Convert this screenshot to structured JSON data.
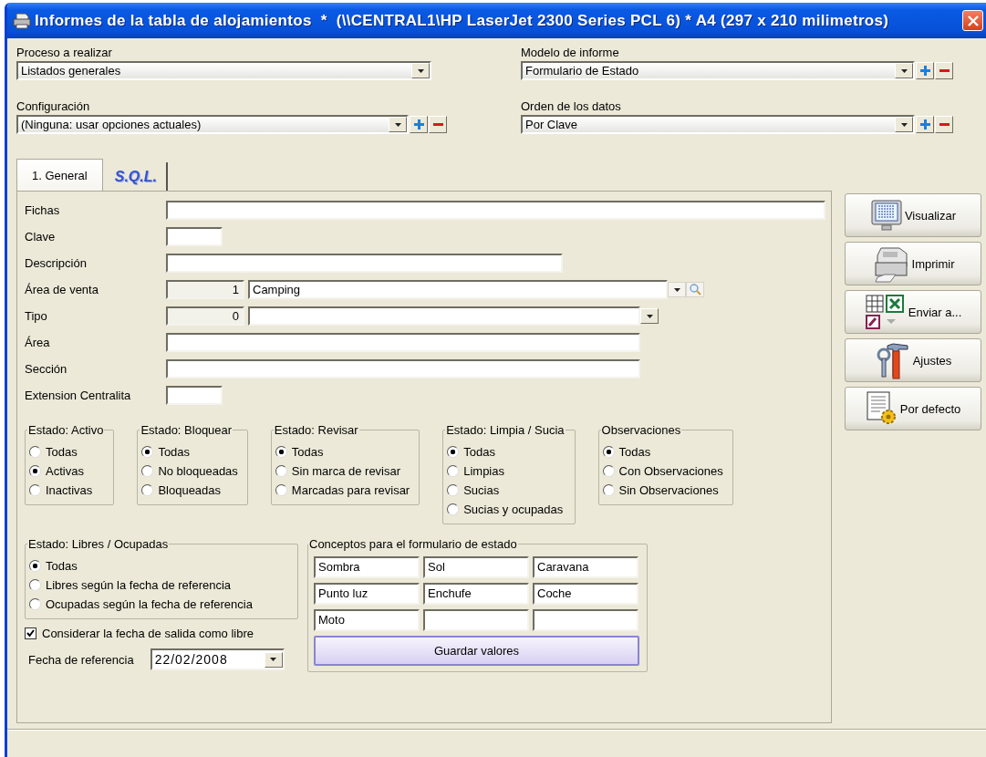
{
  "window": {
    "title": "Informes de la tabla de alojamientos  *  (\\\\CENTRAL1\\HP LaserJet 2300 Series PCL 6) * A4 (297 x 210 milimetros)"
  },
  "top_fields": [
    {
      "label": "Proceso a realizar",
      "value": "Listados generales",
      "kind": "combo"
    },
    {
      "label": "Modelo de informe",
      "value": "Formulario de Estado",
      "kind": "combo-add-remove"
    },
    {
      "label": "Configuración",
      "value": "(Ninguna: usar opciones actuales)",
      "kind": "combo-add-remove"
    },
    {
      "label": "Orden de los datos",
      "value": "Por Clave",
      "kind": "combo-add-remove"
    }
  ],
  "tabs": [
    {
      "label": "1. General",
      "selected": true,
      "kind": "plain"
    },
    {
      "label": "S.Q.L.",
      "selected": false,
      "kind": "styled"
    }
  ],
  "form_fields": [
    {
      "label": "Fichas",
      "kind": "wide"
    },
    {
      "label": "Clave",
      "kind": "short"
    },
    {
      "label": "Descripción",
      "kind": "medium"
    },
    {
      "label": "Área de venta",
      "kind": "lookup",
      "code": "1",
      "value": "Camping"
    },
    {
      "label": "Tipo",
      "kind": "code-combo",
      "code": "0"
    },
    {
      "label": "Área",
      "kind": "long"
    },
    {
      "label": "Sección",
      "kind": "long"
    },
    {
      "label": "Extension Centralita",
      "kind": "short"
    }
  ],
  "radio_groups": [
    {
      "title": "Estado: Activo",
      "options": [
        {
          "label": "Todas",
          "selected": false
        },
        {
          "label": "Activas",
          "selected": true
        },
        {
          "label": "Inactivas",
          "selected": false
        }
      ]
    },
    {
      "title": "Estado: Bloquear",
      "options": [
        {
          "label": "Todas",
          "selected": true
        },
        {
          "label": "No bloqueadas",
          "selected": false
        },
        {
          "label": "Bloqueadas",
          "selected": false
        }
      ]
    },
    {
      "title": "Estado: Revisar",
      "options": [
        {
          "label": "Todas",
          "selected": true
        },
        {
          "label": "Sin marca de revisar",
          "selected": false
        },
        {
          "label": "Marcadas para revisar",
          "selected": false
        }
      ]
    },
    {
      "title": "Estado: Limpia / Sucia",
      "options": [
        {
          "label": "Todas",
          "selected": true
        },
        {
          "label": "Limpias",
          "selected": false
        },
        {
          "label": "Sucias",
          "selected": false
        },
        {
          "label": "Sucias y ocupadas",
          "selected": false
        }
      ]
    },
    {
      "title": "Observaciones",
      "options": [
        {
          "label": "Todas",
          "selected": true
        },
        {
          "label": "Con Observaciones",
          "selected": false
        },
        {
          "label": "Sin Observaciones",
          "selected": false
        }
      ]
    }
  ],
  "occupancy_group": {
    "title": "Estado: Libres / Ocupadas",
    "options": [
      {
        "label": "Todas",
        "selected": true
      },
      {
        "label": "Libres según la fecha de referencia",
        "selected": false
      },
      {
        "label": "Ocupadas según la fecha de referencia",
        "selected": false
      }
    ]
  },
  "checkbox": {
    "label": "Considerar la fecha de salida como libre",
    "checked": true
  },
  "reference_date": {
    "label": "Fecha de referencia",
    "value": "22/02/2008"
  },
  "concepts": {
    "title": "Conceptos para el formulario de estado",
    "cells": [
      {
        "value": "Sombra"
      },
      {
        "value": "Sol"
      },
      {
        "value": "Caravana"
      },
      {
        "value": "Punto luz"
      },
      {
        "value": "Enchufe"
      },
      {
        "value": "Coche"
      },
      {
        "value": "Moto"
      },
      {},
      {}
    ],
    "button": "Guardar valores"
  },
  "action_buttons": [
    {
      "label": "Visualizar",
      "kind": "view"
    },
    {
      "label": "Imprimir",
      "kind": "print"
    },
    {
      "label": "Enviar a...",
      "kind": "send"
    },
    {
      "label": "Ajustes",
      "kind": "settings"
    },
    {
      "label": "Por defecto",
      "kind": "defaults"
    }
  ]
}
